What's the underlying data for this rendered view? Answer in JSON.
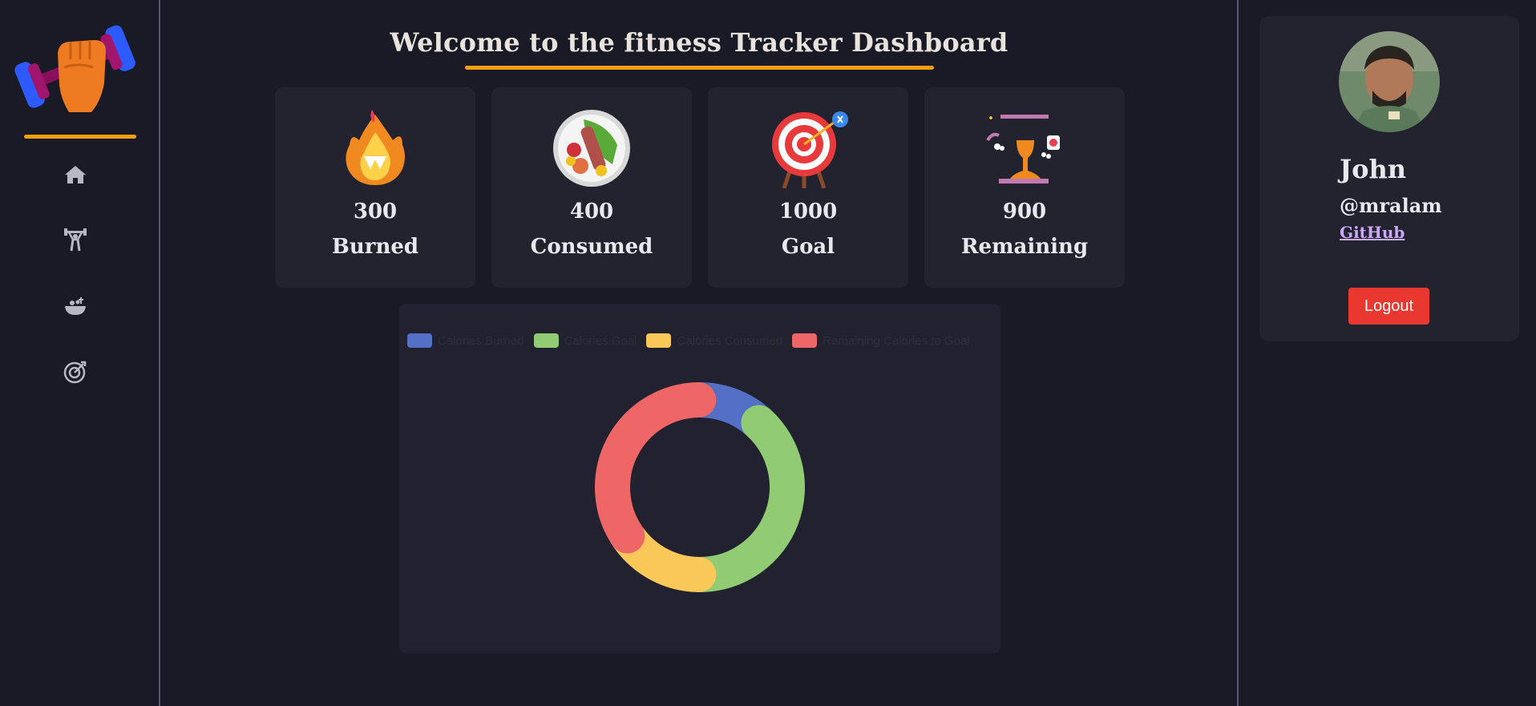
{
  "sidebar": {
    "logo": "dumbbell-fist-logo",
    "items": [
      {
        "icon": "home-icon"
      },
      {
        "icon": "weightlifter-icon"
      },
      {
        "icon": "food-bowl-icon"
      },
      {
        "icon": "target-icon"
      }
    ]
  },
  "header": {
    "title": "Welcome to the fitness Tracker Dashboard"
  },
  "stats": [
    {
      "value": "300",
      "label": "Burned",
      "icon": "flame-icon"
    },
    {
      "value": "400",
      "label": "Consumed",
      "icon": "food-plate-icon"
    },
    {
      "value": "1000",
      "label": "Goal",
      "icon": "goal-target-icon"
    },
    {
      "value": "900",
      "label": "Remaining",
      "icon": "hourglass-icon"
    }
  ],
  "chart_data": {
    "type": "doughnut",
    "series": [
      {
        "name": "Calories Burned",
        "value": 300,
        "color": "#5470c6"
      },
      {
        "name": "Calories Goal",
        "value": 1000,
        "color": "#91cc75"
      },
      {
        "name": "Calories Consumed",
        "value": 400,
        "color": "#fac858"
      },
      {
        "name": "Remaining Calories to Goal",
        "value": 900,
        "color": "#ee6666"
      }
    ],
    "legend_position": "top"
  },
  "profile": {
    "name": "John",
    "handle": "@mralam",
    "link_label": "GitHub",
    "logout_label": "Logout"
  }
}
